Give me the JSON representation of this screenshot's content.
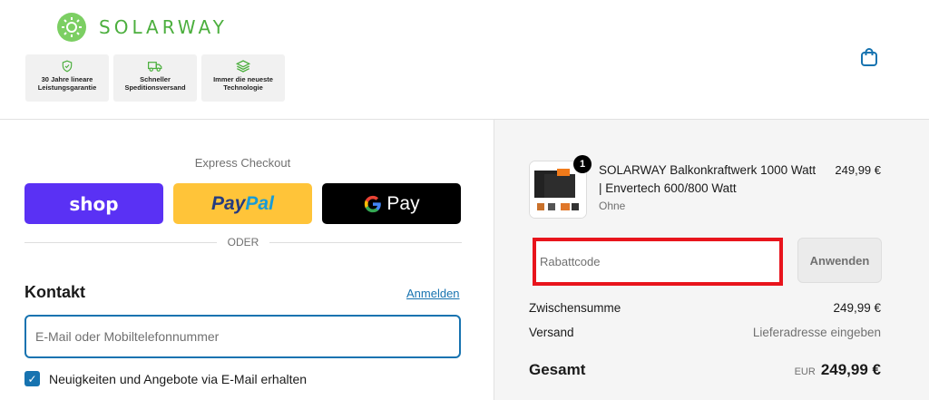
{
  "brand": {
    "name": "SOLARWAY",
    "color": "#4caf3e"
  },
  "badges": [
    {
      "icon": "shield-check-icon",
      "text": "30 Jahre lineare Leistungsgarantie"
    },
    {
      "icon": "truck-icon",
      "text": "Schneller Speditionsversand"
    },
    {
      "icon": "layers-icon",
      "text": "Immer die neueste Technologie"
    }
  ],
  "header": {
    "cart_icon": "shopping-bag-icon"
  },
  "express": {
    "title": "Express Checkout",
    "shop_label": "shop",
    "paypal_label": "PayPal",
    "gpay_label": "Pay",
    "divider": "ODER"
  },
  "contact": {
    "title": "Kontakt",
    "login_link": "Anmelden",
    "email_placeholder": "E-Mail oder Mobiltelefonnummer",
    "newsletter_label": "Neuigkeiten und Angebote via E-Mail erhalten",
    "newsletter_checked": true
  },
  "order": {
    "item": {
      "quantity": "1",
      "name": "SOLARWAY Balkonkraftwerk 1000 Watt | Envertech 600/800 Watt",
      "variant": "Ohne",
      "price": "249,99 €"
    },
    "discount_placeholder": "Rabattcode",
    "apply_label": "Anwenden",
    "subtotal_label": "Zwischensumme",
    "subtotal_value": "249,99 €",
    "shipping_label": "Versand",
    "shipping_value": "Lieferadresse eingeben",
    "total_label": "Gesamt",
    "currency": "EUR",
    "total_value": "249,99 €"
  },
  "colors": {
    "accent": "#1773b0",
    "highlight": "#e8141c",
    "shop": "#5a31f4",
    "paypal": "#ffc439"
  }
}
